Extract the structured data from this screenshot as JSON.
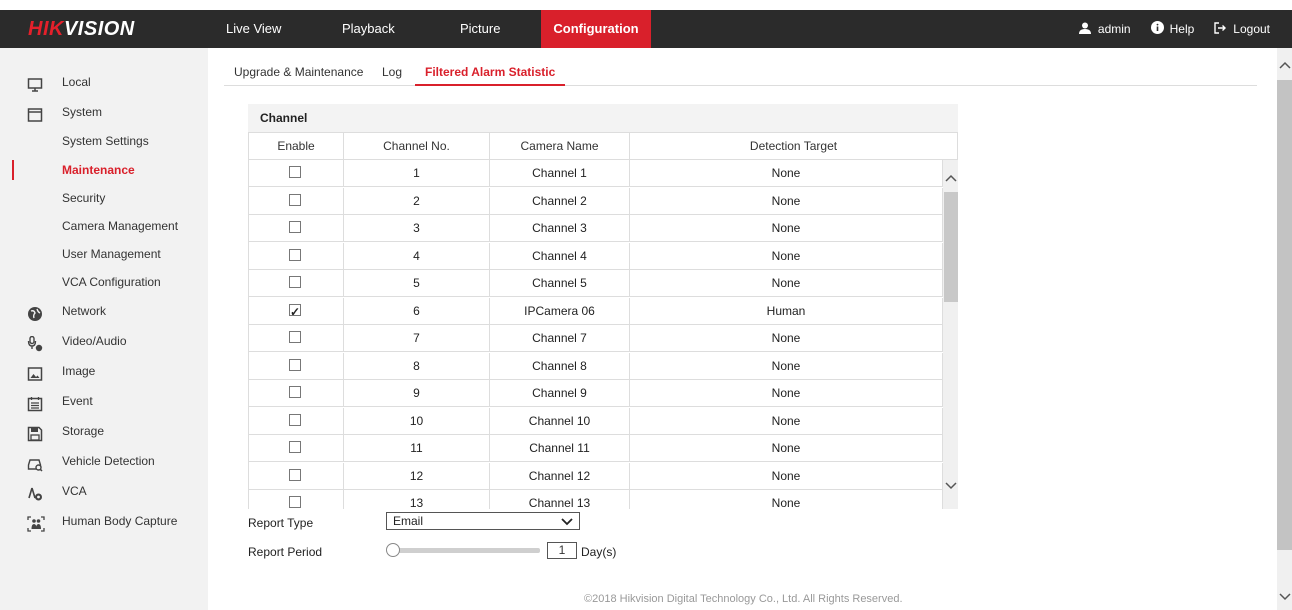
{
  "brand": {
    "logo_part1": "HIK",
    "logo_part2": "VISION"
  },
  "topnav": {
    "items": [
      "Live View",
      "Playback",
      "Picture",
      "Configuration"
    ],
    "active": "Configuration",
    "user": "admin",
    "help": "Help",
    "logout": "Logout"
  },
  "sidebar": {
    "items": [
      {
        "label": "Local",
        "icon": "monitor-icon"
      },
      {
        "label": "System",
        "icon": "system-icon"
      },
      {
        "label": "System Settings",
        "sub": true
      },
      {
        "label": "Maintenance",
        "sub": true,
        "active": true
      },
      {
        "label": "Security",
        "sub": true
      },
      {
        "label": "Camera Management",
        "sub": true
      },
      {
        "label": "User Management",
        "sub": true
      },
      {
        "label": "VCA Configuration",
        "sub": true
      },
      {
        "label": "Network",
        "icon": "globe-icon"
      },
      {
        "label": "Video/Audio",
        "icon": "video-audio-icon"
      },
      {
        "label": "Image",
        "icon": "image-icon"
      },
      {
        "label": "Event",
        "icon": "event-icon"
      },
      {
        "label": "Storage",
        "icon": "storage-icon"
      },
      {
        "label": "Vehicle Detection",
        "icon": "vehicle-icon"
      },
      {
        "label": "VCA",
        "icon": "vca-icon"
      },
      {
        "label": "Human Body Capture",
        "icon": "human-body-icon"
      }
    ]
  },
  "tabs": {
    "items": [
      "Upgrade & Maintenance",
      "Log",
      "Filtered Alarm Statistic"
    ],
    "active": "Filtered Alarm Statistic"
  },
  "channel_panel": {
    "title": "Channel",
    "columns": [
      "Enable",
      "Channel No.",
      "Camera Name",
      "Detection Target"
    ],
    "rows": [
      {
        "enabled": false,
        "no": "1",
        "name": "Channel 1",
        "target": "None"
      },
      {
        "enabled": false,
        "no": "2",
        "name": "Channel 2",
        "target": "None"
      },
      {
        "enabled": false,
        "no": "3",
        "name": "Channel 3",
        "target": "None"
      },
      {
        "enabled": false,
        "no": "4",
        "name": "Channel 4",
        "target": "None"
      },
      {
        "enabled": false,
        "no": "5",
        "name": "Channel 5",
        "target": "None"
      },
      {
        "enabled": true,
        "no": "6",
        "name": "IPCamera 06",
        "target": "Human"
      },
      {
        "enabled": false,
        "no": "7",
        "name": "Channel 7",
        "target": "None"
      },
      {
        "enabled": false,
        "no": "8",
        "name": "Channel 8",
        "target": "None"
      },
      {
        "enabled": false,
        "no": "9",
        "name": "Channel 9",
        "target": "None"
      },
      {
        "enabled": false,
        "no": "10",
        "name": "Channel 10",
        "target": "None"
      },
      {
        "enabled": false,
        "no": "11",
        "name": "Channel 11",
        "target": "None"
      },
      {
        "enabled": false,
        "no": "12",
        "name": "Channel 12",
        "target": "None"
      },
      {
        "enabled": false,
        "no": "13",
        "name": "Channel 13",
        "target": "None"
      }
    ]
  },
  "report": {
    "type_label": "Report Type",
    "type_value": "Email",
    "period_label": "Report Period",
    "period_value": "1",
    "period_unit": "Day(s)"
  },
  "footer": "©2018 Hikvision Digital Technology Co., Ltd. All Rights Reserved.",
  "colors": {
    "accent": "#d9202b",
    "topbar": "#2b2b2b",
    "sidebar": "#f2f2f2"
  }
}
